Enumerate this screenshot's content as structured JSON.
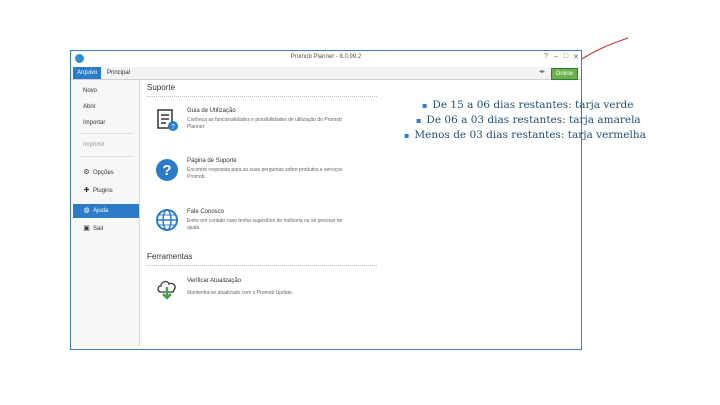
{
  "window": {
    "title": "Promob Planner - 8.0.99.2",
    "controls": [
      "?",
      "–",
      "□",
      "✕"
    ]
  },
  "ribbon": {
    "tabs": [
      "Arquivo",
      "Principal"
    ],
    "online_label": "Online",
    "arrows": "◂▸"
  },
  "sidebar": {
    "items": [
      {
        "label": "Novo",
        "icon": "none"
      },
      {
        "label": "Abrir",
        "icon": "none"
      },
      {
        "label": "Importar",
        "icon": "none"
      },
      {
        "label": "Imprimir",
        "icon": "none",
        "disabled": true
      },
      {
        "label": "Opções",
        "icon": "gear-icon"
      },
      {
        "label": "Plugins",
        "icon": "puzzle-icon"
      },
      {
        "label": "Ajuda",
        "icon": "globe-icon",
        "active": true
      },
      {
        "label": "Sair",
        "icon": "exit-icon"
      }
    ]
  },
  "support": {
    "section_title": "Suporte",
    "items": [
      {
        "title": "Guia de Utilização",
        "desc": "Conheça as funcionalidades e possibilidades de utilização do Promob Planner.",
        "icon": "document-help-icon"
      },
      {
        "title": "Página de Suporte",
        "desc": "Encontre respostas para as suas perguntas sobre produtos e serviços Promob.",
        "icon": "question-icon"
      },
      {
        "title": "Fale Conosco",
        "desc": "Entre em contato caso tenha sugestões de melhoria ou se precisar de ajuda.",
        "icon": "globe-icon"
      }
    ]
  },
  "tools": {
    "section_title": "Ferramentas",
    "items": [
      {
        "title": "Verificar Atualização",
        "desc": "Mantenha-se atualizado com o Promob Update.",
        "icon": "cloud-download-icon"
      }
    ]
  },
  "notes": {
    "bullet": "▪",
    "lines": [
      "De 15 a 06 dias restantes: tarja verde",
      "De 06 a 03 dias restantes: tarja amarela",
      "Menos de 03 dias restantes: tarja vermelha"
    ]
  },
  "colors": {
    "accent": "#2b7bc8",
    "online": "#6ab04c",
    "annotation_arrow": "#d32f2f"
  }
}
